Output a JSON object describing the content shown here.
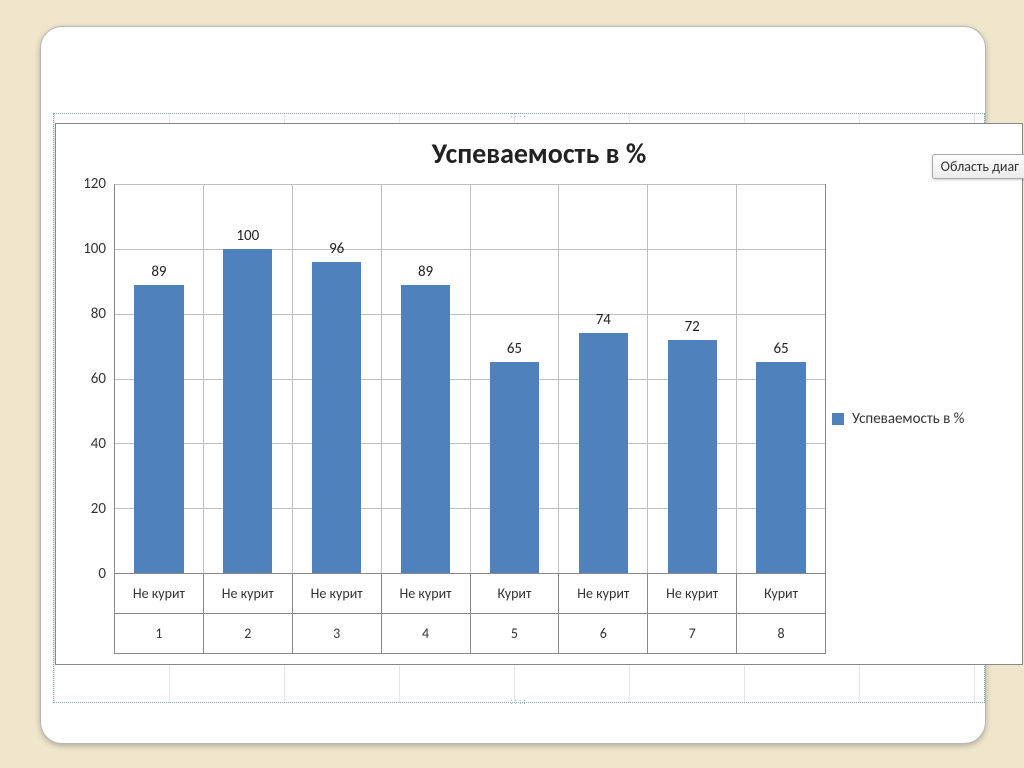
{
  "chart_data": {
    "type": "bar",
    "title": "Успеваемость в %",
    "ylabel": "",
    "xlabel": "",
    "ylim": [
      0,
      120
    ],
    "yticks": [
      0,
      20,
      40,
      60,
      80,
      100,
      120
    ],
    "categories_top": [
      "Не курит",
      "Не курит",
      "Не курит",
      "Не курит",
      "Курит",
      "Не курит",
      "Не курит",
      "Курит"
    ],
    "categories_bottom": [
      "1",
      "2",
      "3",
      "4",
      "5",
      "6",
      "7",
      "8"
    ],
    "series": [
      {
        "name": "Успеваемость в %",
        "values": [
          89,
          100,
          96,
          89,
          65,
          74,
          72,
          65
        ]
      }
    ]
  },
  "tooltip_text": "Область диаг",
  "legend_label": "Успеваемость в %"
}
